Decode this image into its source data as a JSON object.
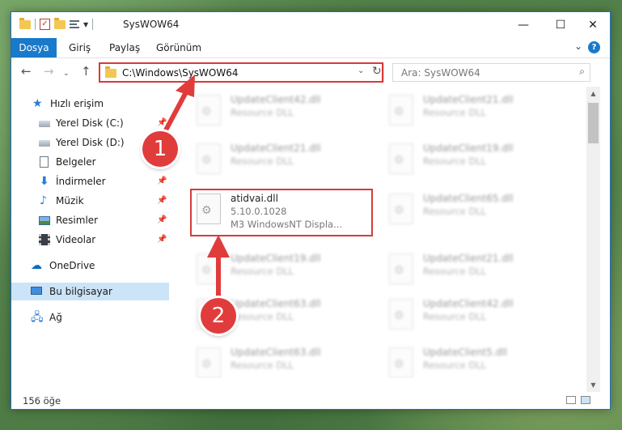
{
  "window": {
    "title": "SysWOW64",
    "controls": {
      "minimize": "—",
      "maximize": "☐",
      "close": "✕"
    }
  },
  "ribbon": {
    "tabs": [
      "Dosya",
      "Giriş",
      "Paylaş",
      "Görünüm"
    ],
    "help": "?"
  },
  "address": {
    "path": "C:\\Windows\\SysWOW64",
    "search_placeholder": "Ara: SysWOW64"
  },
  "sidebar": {
    "items": [
      {
        "label": "Hızlı erişim",
        "icon": "star-icon"
      },
      {
        "label": "Yerel Disk (C:)",
        "icon": "drive-icon",
        "pinned": true
      },
      {
        "label": "Yerel Disk (D:)",
        "icon": "drive-icon"
      },
      {
        "label": "Belgeler",
        "icon": "documents-icon"
      },
      {
        "label": "İndirmeler",
        "icon": "download-icon",
        "pinned": true
      },
      {
        "label": "Müzik",
        "icon": "music-icon",
        "pinned": true
      },
      {
        "label": "Resimler",
        "icon": "pictures-icon",
        "pinned": true
      },
      {
        "label": "Videolar",
        "icon": "videos-icon",
        "pinned": true
      },
      {
        "label": "OneDrive",
        "icon": "cloud-icon"
      },
      {
        "label": "Bu bilgisayar",
        "icon": "computer-icon",
        "selected": true
      },
      {
        "label": "Ağ",
        "icon": "network-icon"
      }
    ]
  },
  "files": {
    "left": [
      {
        "name": "UpdateClient42.dll",
        "desc": "Resource DLL"
      },
      {
        "name": "UpdateClient21.dll",
        "desc": "Resource DLL"
      },
      {
        "name": "atidvai.dll",
        "version": "5.10.0.1028",
        "desc": "M3 WindowsNT Displa..."
      },
      {
        "name": "UpdateClient19.dll",
        "desc": "Resource DLL"
      },
      {
        "name": "UpdateClient63.dll",
        "desc": "Resource DLL"
      },
      {
        "name": "UpdateClient63.dll",
        "desc": "Resource DLL"
      }
    ],
    "right": [
      {
        "name": "UpdateClient21.dll",
        "desc": "Resource DLL"
      },
      {
        "name": "UpdateClient19.dll",
        "desc": "Resource DLL"
      },
      {
        "name": "UpdateClient65.dll",
        "desc": "Resource DLL"
      },
      {
        "name": "UpdateClient21.dll",
        "desc": "Resource DLL"
      },
      {
        "name": "UpdateClient42.dll",
        "desc": "Resource DLL"
      },
      {
        "name": "UpdateClient5.dll",
        "desc": "Resource DLL"
      }
    ]
  },
  "status": {
    "count": "156 öğe"
  },
  "annotations": {
    "step1": "1",
    "step2": "2",
    "color": "#e03c3c"
  }
}
